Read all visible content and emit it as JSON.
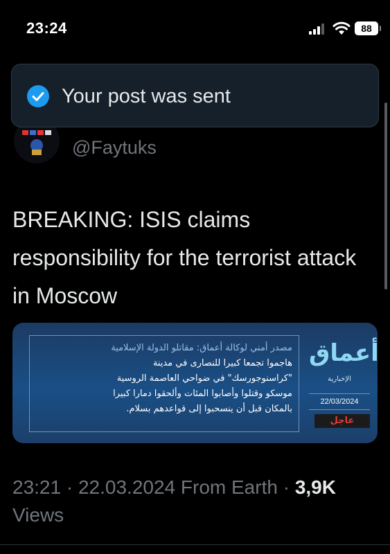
{
  "status_bar": {
    "time": "23:24",
    "battery": "88"
  },
  "toast": {
    "message": "Your post was sent"
  },
  "author": {
    "handle": "@Faytuks"
  },
  "tweet": {
    "text": "BREAKING: ISIS claims responsibility for the terrorist attack in Moscow"
  },
  "media": {
    "source_line": "مصدر أمني لوكالة أعماق: مقاتلو الدولة الإسلامية",
    "lines": [
      "هاجموا تجمعا كبيرا للنصارى في مدينة",
      "\"كراسنوجورسك\" في ضواحي العاصمة الروسية",
      "موسكو وقتلوا وأصابوا المئات وألحقوا دمارا كبيرا",
      "بالمكان قبل أن ينسحبوا إلى قواعدهم بسلام."
    ],
    "logo": "أعماق",
    "logo_sub": "الإخبارية",
    "date": "22/03/2024",
    "urgent": "عاجل"
  },
  "meta": {
    "time": "23:21",
    "date": "22.03.2024",
    "location": "From Earth",
    "views_count": "3,9K",
    "views_label": "Views"
  },
  "colors": {
    "accent": "#1d9bf0",
    "muted": "#71767b",
    "background": "#000000"
  }
}
